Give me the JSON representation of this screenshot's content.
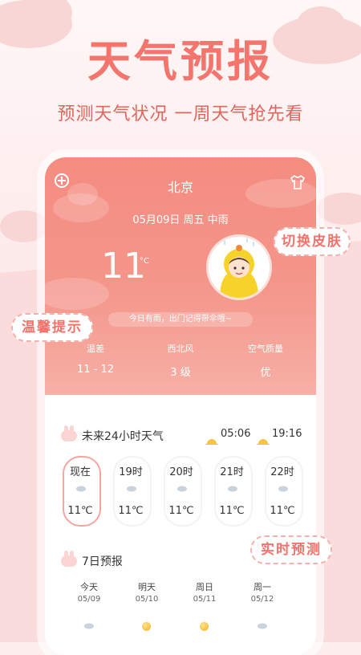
{
  "headline": "天气预报",
  "subheadline": "预测天气状况 一周天气抢先看",
  "phone": {
    "city": "北京",
    "date_line": "05月09日 周五 中雨",
    "temperature": "11",
    "temp_unit": "°C",
    "tip": "今日有雨，出门记得带伞哦~",
    "stats": [
      {
        "label": "温差",
        "value": "11 - 12"
      },
      {
        "label": "西北风",
        "value": "3 级"
      },
      {
        "label": "空气质量",
        "value": "优"
      }
    ],
    "hourly": {
      "title": "未来24小时天气",
      "sunrise": "05:06",
      "sunset": "19:16",
      "items": [
        {
          "label": "现在",
          "temp": "11℃"
        },
        {
          "label": "19时",
          "temp": "11℃"
        },
        {
          "label": "20时",
          "temp": "11℃"
        },
        {
          "label": "21时",
          "temp": "11℃"
        },
        {
          "label": "22时",
          "temp": "11℃"
        }
      ]
    },
    "weekly": {
      "title": "7日预报",
      "days": [
        {
          "name": "今天",
          "date": "05/09"
        },
        {
          "name": "明天",
          "date": "05/10"
        },
        {
          "name": "周日",
          "date": "05/11"
        },
        {
          "name": "周一",
          "date": "05/12"
        }
      ]
    }
  },
  "stickers": {
    "skin": "切换皮肤",
    "reminder": "温馨提示",
    "realtime": "实时预测"
  },
  "colors": {
    "brand": "#f4756d",
    "header_top": "#f58c80",
    "sticker_border": "#f3b2ad"
  }
}
